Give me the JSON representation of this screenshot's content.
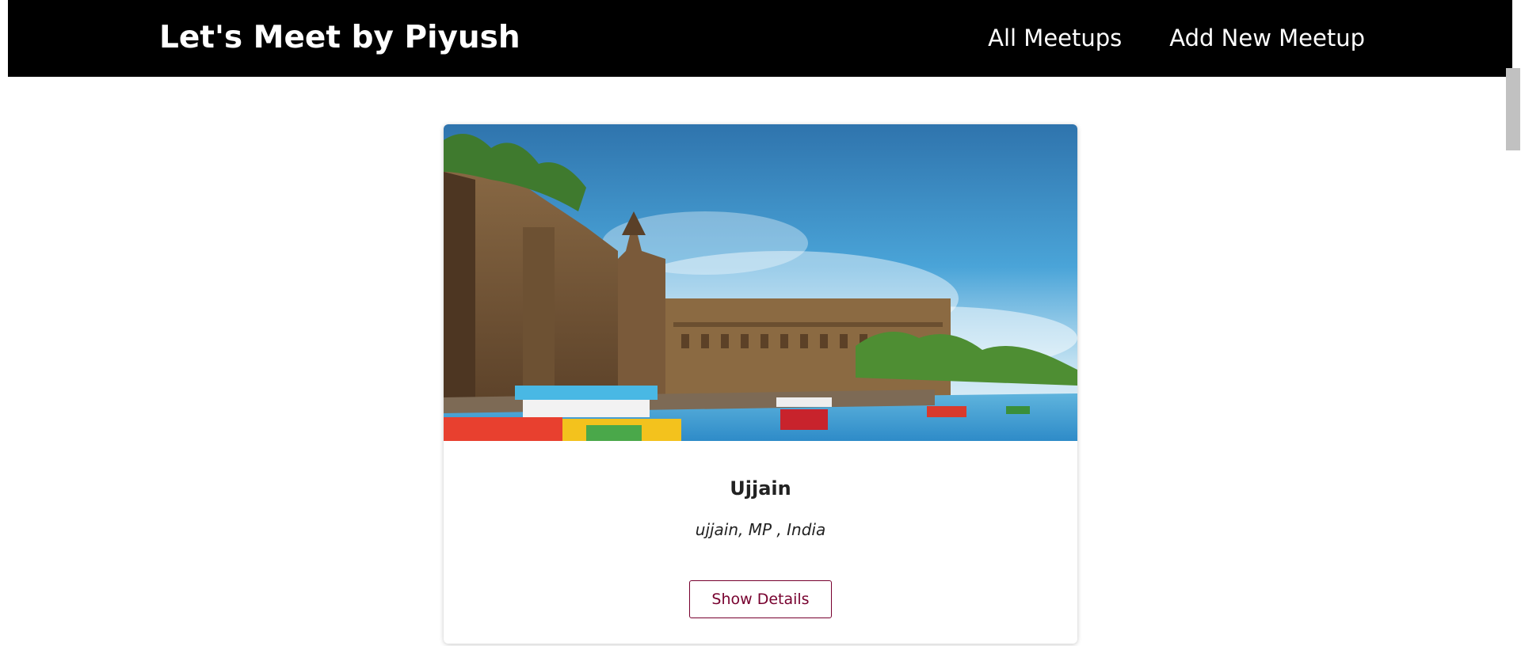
{
  "header": {
    "logo": "Let's Meet by Piyush",
    "nav": [
      {
        "label": "All Meetups"
      },
      {
        "label": "Add New Meetup"
      }
    ]
  },
  "meetup": {
    "image_alt": "Ujjain",
    "title": "Ujjain",
    "address": "ujjain, MP , India",
    "button_label": "Show Details"
  },
  "colors": {
    "header_bg": "#000000",
    "header_text": "#ffffff",
    "button_accent": "#77002e"
  }
}
